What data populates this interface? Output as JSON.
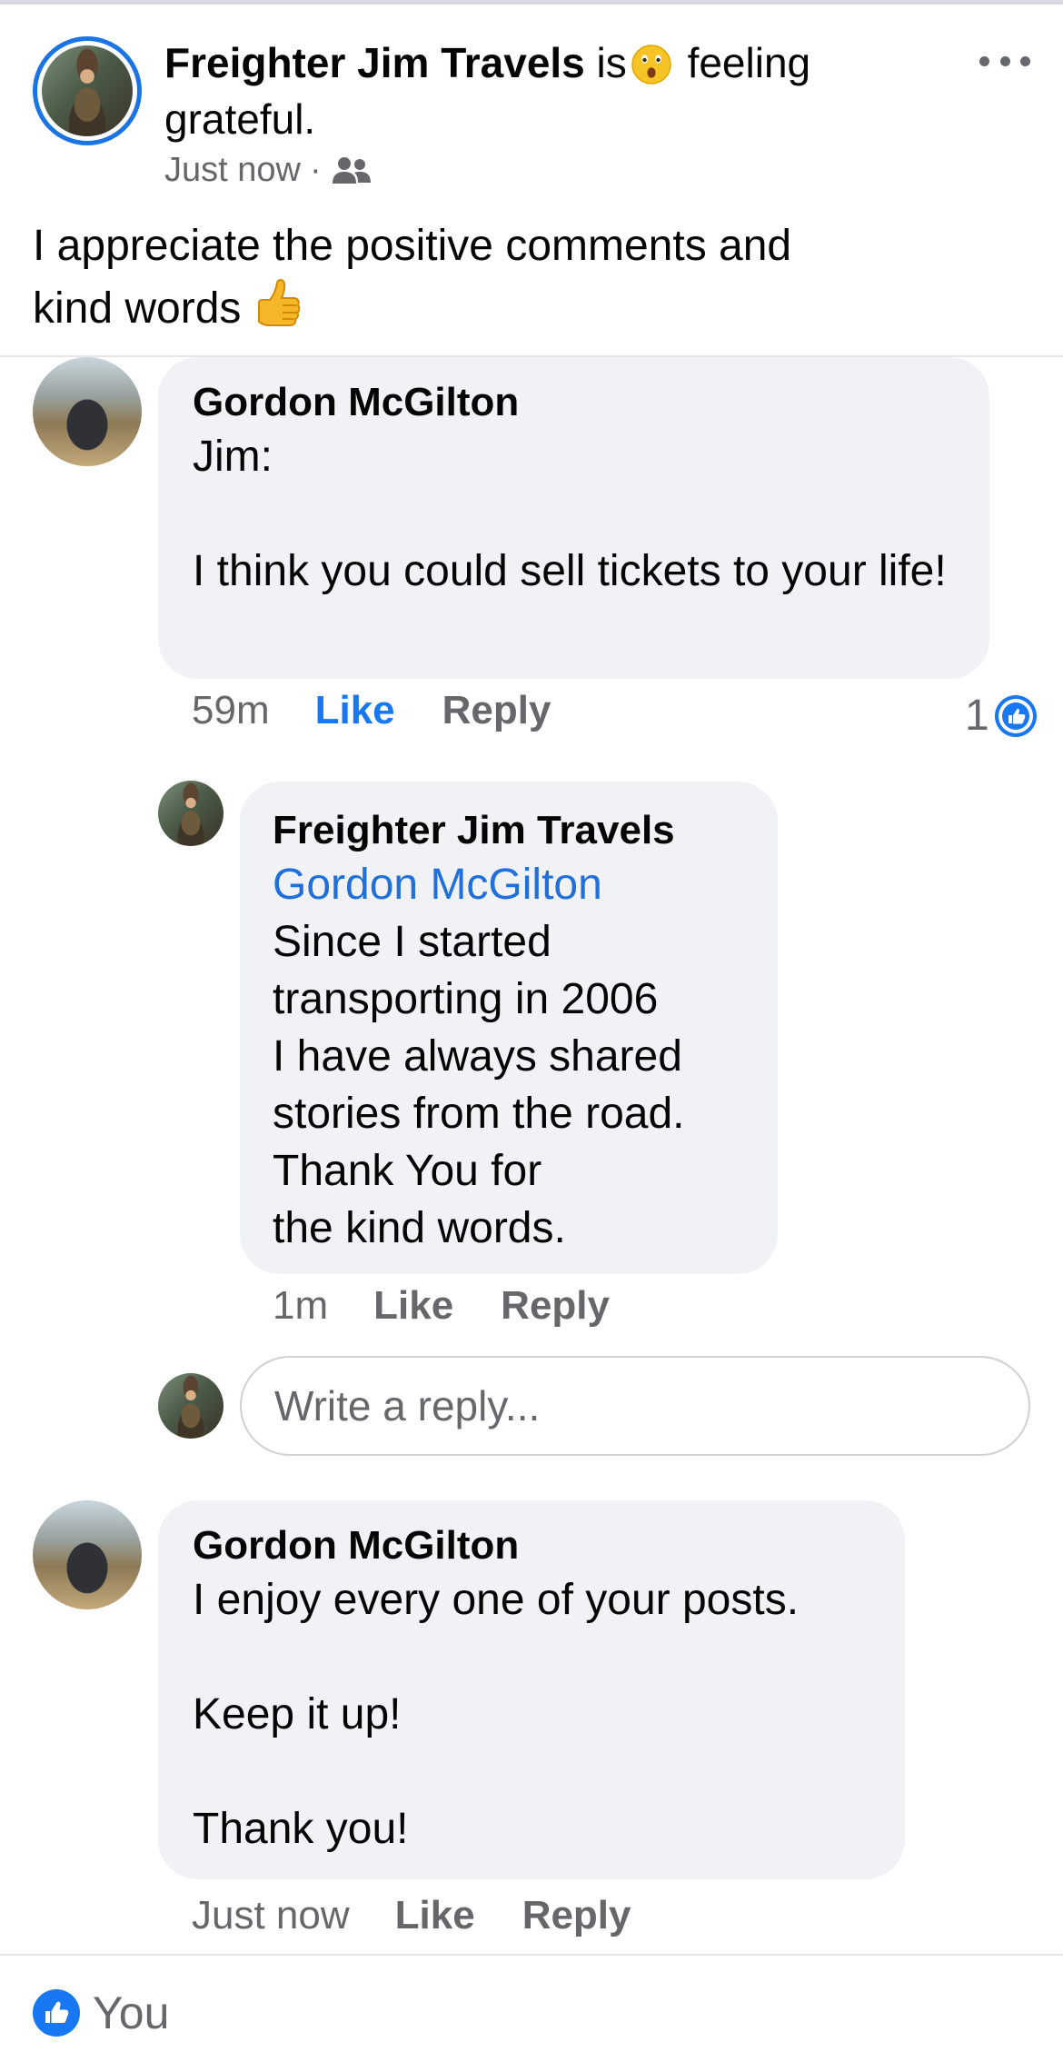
{
  "post": {
    "author": "Freighter Jim Travels",
    "activity_prefix": "is",
    "feeling_emoji": "surprised-face-emoji",
    "activity_text": "feeling grateful.",
    "timestamp": "Just now",
    "separator": "·",
    "audience_icon": "friends-icon",
    "body": "I appreciate the positive comments and kind words",
    "body_emoji": "thumbs-up-emoji"
  },
  "comments": [
    {
      "author": "Gordon McGilton",
      "text": "Jim:\n\nI think you could sell tickets to your life!",
      "time": "59m",
      "like_label": "Like",
      "reply_label": "Reply",
      "reaction_count": "1",
      "replies": [
        {
          "author": "Freighter Jim Travels",
          "mention": "Gordon McGilton",
          "text": "Since I started\ntransporting in 2006\nI have always shared\nstories from the road.\nThank You for\nthe kind words.",
          "time": "1m",
          "like_label": "Like",
          "reply_label": "Reply"
        }
      ],
      "reply_placeholder": "Write a reply..."
    },
    {
      "author": "Gordon McGilton",
      "text": "I enjoy every one of your posts.\n\nKeep it up!\n\nThank you!",
      "time": "Just now",
      "like_label": "Like",
      "reply_label": "Reply"
    }
  ],
  "reactions_footer": {
    "label": "You",
    "icon": "like-reaction-icon"
  },
  "colors": {
    "accent": "#1877f2",
    "link": "#216fdb",
    "bubble": "#f0f2f5",
    "secondary_text": "#65676b"
  }
}
